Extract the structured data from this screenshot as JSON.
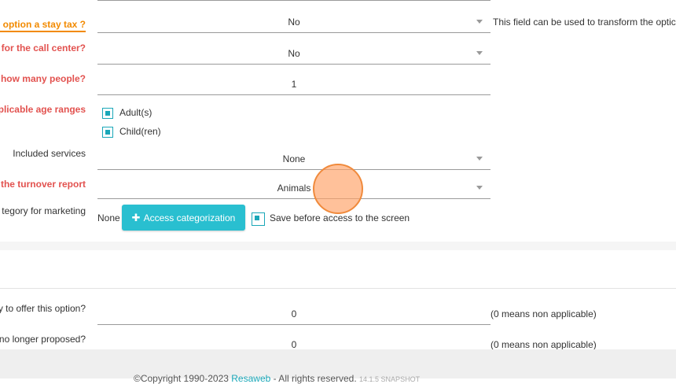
{
  "form": {
    "stay_tax": {
      "label": "he option a stay tax ?",
      "value": "No",
      "hint": "This field can be used to transform the optic"
    },
    "call_center": {
      "label": "y for the call center?",
      "value": "No"
    },
    "how_many": {
      "label": "n how many people?",
      "value": "1"
    },
    "age_ranges": {
      "label": "pplicable age ranges",
      "options": [
        "Adult(s)",
        "Child(ren)"
      ]
    },
    "included_services": {
      "label": "Included services",
      "value": "None"
    },
    "turnover": {
      "label": "n the turnover report",
      "value": "Animals"
    },
    "marketing": {
      "label": "tegory for marketing",
      "value": "None",
      "button": "Access categorization",
      "save_label": "Save before access to the screen"
    },
    "offer": {
      "label": "y to offer this option?",
      "value": "0",
      "hint": "(0 means non applicable)"
    },
    "no_longer": {
      "label": "no longer proposed?",
      "value": "0",
      "hint": "(0 means non applicable)"
    }
  },
  "footer": {
    "copyright": "©Copyright 1990-2023",
    "brand": "Resaweb",
    "rights": "- All rights reserved.",
    "version": "14.1.5 SNAPSHOT"
  }
}
